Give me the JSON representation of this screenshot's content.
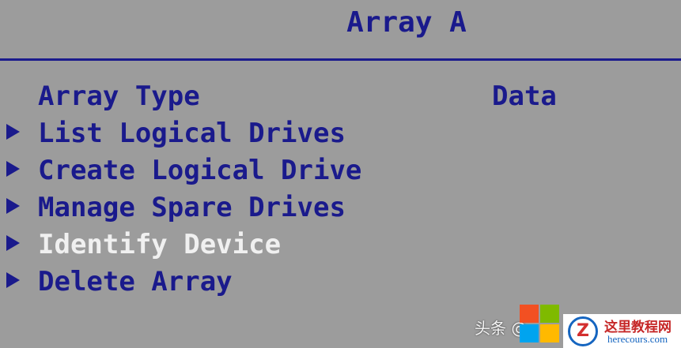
{
  "header": {
    "title": "Array A"
  },
  "menu": {
    "items": [
      {
        "label": "Array Type",
        "value": "Data",
        "has_arrow": false,
        "selected": false
      },
      {
        "label": "List Logical Drives",
        "has_arrow": true,
        "selected": false
      },
      {
        "label": "Create Logical Drive",
        "has_arrow": true,
        "selected": false
      },
      {
        "label": "Manage Spare Drives",
        "has_arrow": true,
        "selected": false
      },
      {
        "label": "Identify Device",
        "has_arrow": true,
        "selected": true
      },
      {
        "label": "Delete Array",
        "has_arrow": true,
        "selected": false
      }
    ]
  },
  "watermark": {
    "source_text": "头条 @",
    "site_name": "这里教程网",
    "site_url": "herecours.com"
  },
  "colors": {
    "background": "#9c9c9c",
    "text": "#1a1a8c",
    "selected_text": "#f0f0f0"
  }
}
